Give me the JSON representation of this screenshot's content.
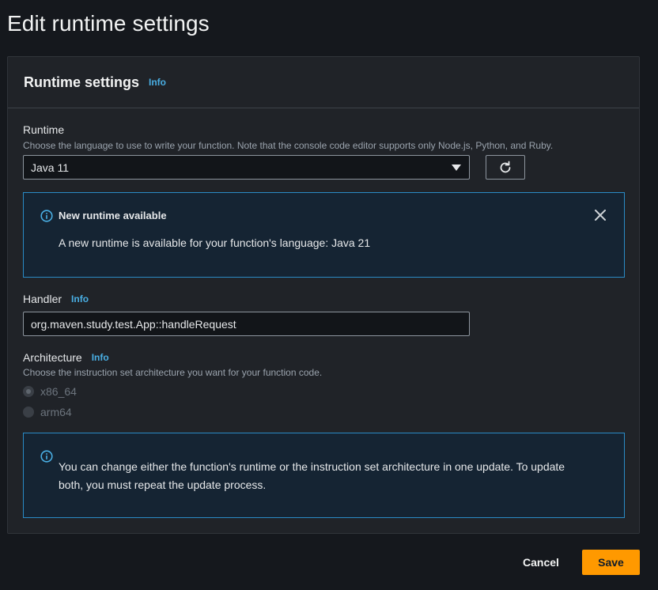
{
  "page": {
    "title": "Edit runtime settings"
  },
  "panel": {
    "title": "Runtime settings",
    "info": "Info"
  },
  "runtime": {
    "label": "Runtime",
    "description": "Choose the language to use to write your function. Note that the console code editor supports only Node.js, Python, and Ruby.",
    "selected": "Java 11",
    "refresh_icon": "refresh-icon"
  },
  "runtime_alert": {
    "title": "New runtime available",
    "message": "A new runtime is available for your function's language: Java 21",
    "icon": "info-icon",
    "close_icon": "close-icon"
  },
  "handler": {
    "label": "Handler",
    "info": "Info",
    "value": "org.maven.study.test.App::handleRequest"
  },
  "architecture": {
    "label": "Architecture",
    "info": "Info",
    "description": "Choose the instruction set architecture you want for your function code.",
    "options": [
      {
        "label": "x86_64",
        "checked": true,
        "disabled": true
      },
      {
        "label": "arm64",
        "checked": false,
        "disabled": true
      }
    ]
  },
  "update_alert": {
    "line1": "You can change either the function's runtime or the instruction set architecture in one update. To update",
    "line2": "both, you must repeat the update process.",
    "icon": "info-icon"
  },
  "footer": {
    "cancel": "Cancel",
    "save": "Save"
  },
  "colors": {
    "accent": "#ff9900",
    "link": "#49aee3",
    "alert_border": "#2a8bc6",
    "background": "#15181d",
    "panel": "#202328"
  }
}
